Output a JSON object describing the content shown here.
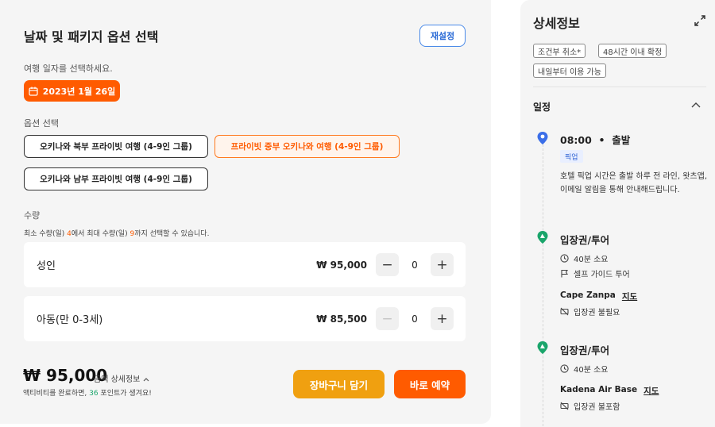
{
  "booking": {
    "title": "날짜 및 패키지 옵션 선택",
    "reset_label": "재설정",
    "date_prompt": "여행 일자를 선택하세요.",
    "selected_date": "2023년 1월 26일",
    "option_label": "옵션 선택",
    "options": [
      {
        "label": "오키나와 북부 프라이빗 여행 (4-9인 그룹)",
        "selected": false
      },
      {
        "label": "프라이빗 중부 오키나와 여행 (4-9인 그룹)",
        "selected": true
      },
      {
        "label": "오키나와 남부 프라이빗 여행 (4-9인 그룹)",
        "selected": false
      }
    ],
    "quantity_label": "수량",
    "quantity_hint": {
      "prefix": "최소 수량(일) ",
      "min": "4",
      "middle": "에서 최대 수량(일) ",
      "max": "9",
      "suffix": "까지 선택할 수 있습니다."
    },
    "rows": [
      {
        "name": "성인",
        "price": "₩ 95,000",
        "qty": "0"
      },
      {
        "name": "아동(만 0-3세)",
        "price": "₩ 85,500",
        "qty": "0"
      }
    ],
    "total_price": "₩ 95,000",
    "price_detail": "금액 상세정보",
    "points_prefix": "액티비티를 완료하면, ",
    "points_value": "36",
    "points_suffix": " 포인트가 생겨요!",
    "cart_label": "장바구니 담기",
    "book_label": "바로 예약"
  },
  "details": {
    "title": "상세정보",
    "tags": [
      "조건부 취소*",
      "48시간 이내 확정",
      "내일부터 이용 가능"
    ],
    "itinerary_title": "일정",
    "start": {
      "time": "08:00",
      "sep": "•",
      "label": "출발",
      "badge": "픽업",
      "text": "호텔 픽업 시간은 출발 하루 전 라인, 왓츠앱, 이메일 알림을 통해 안내해드립니다."
    },
    "steps": [
      {
        "title": "입장권/투어",
        "duration": "40분 소요",
        "guide": "셀프 가이드 투어",
        "place": "Cape Zanpa",
        "map": "지도",
        "ticket": "입장권 불필요"
      },
      {
        "title": "입장권/투어",
        "duration": "40분 소요",
        "place": "Kadena Air Base",
        "map": "지도",
        "ticket": "입장권 불포함"
      }
    ]
  },
  "colors": {
    "orange": "#ff5b00",
    "amber": "#f0a010",
    "blue": "#2b6bd6",
    "green": "#1aa56b"
  }
}
